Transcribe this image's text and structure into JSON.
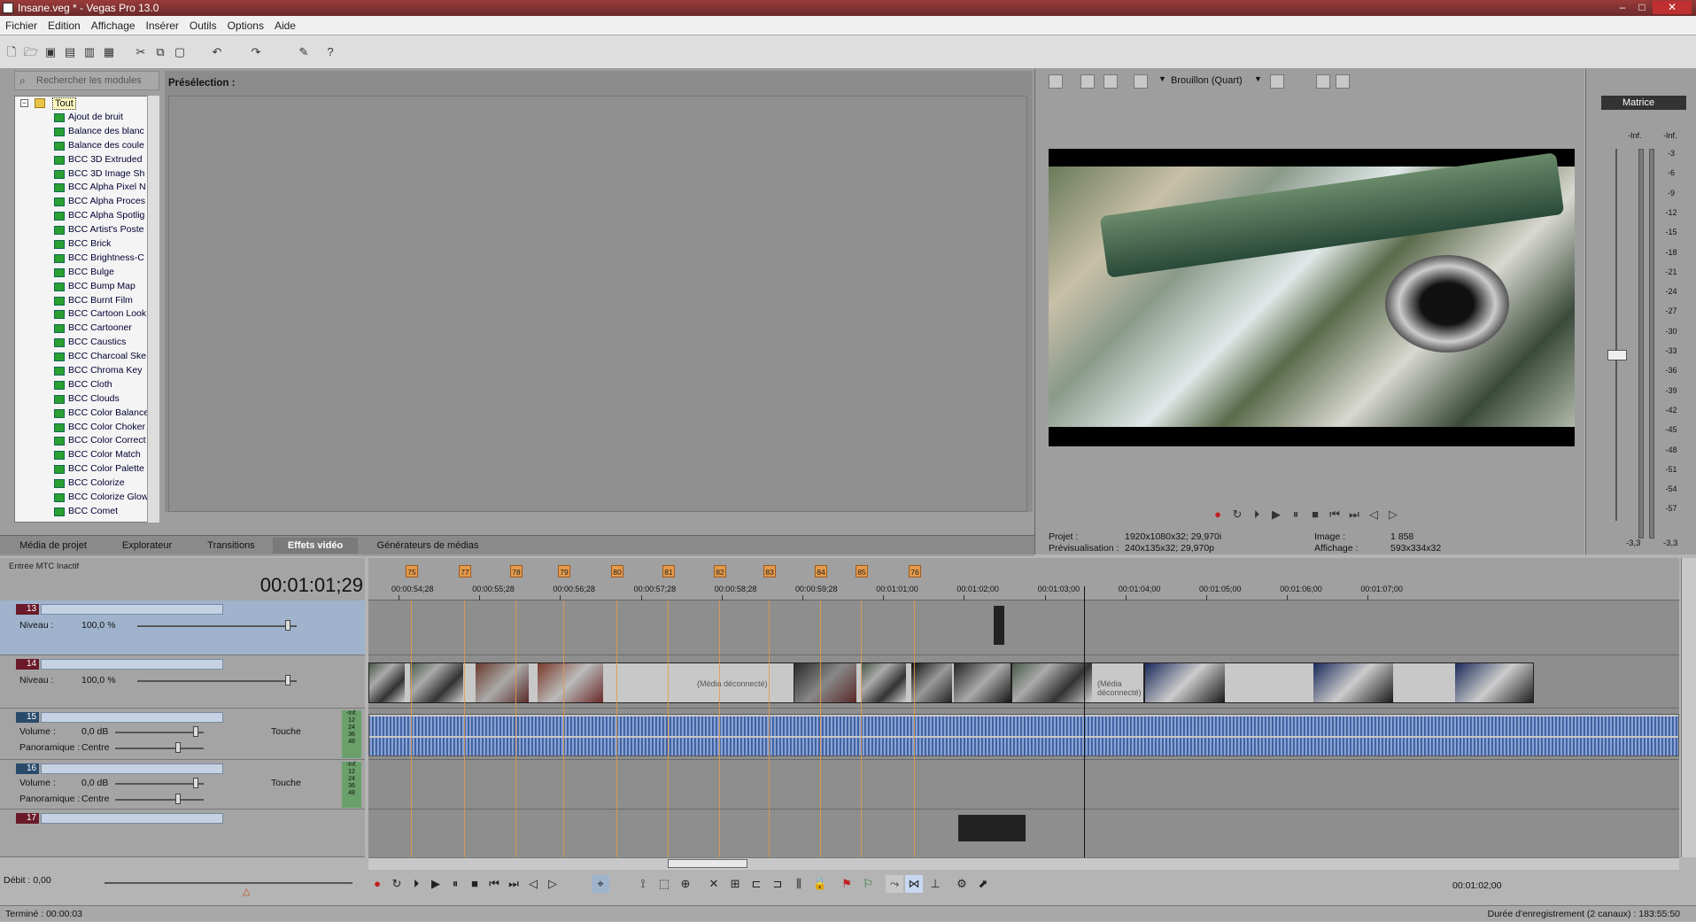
{
  "window": {
    "title": "Insane.veg * - Vegas Pro 13.0",
    "controls": [
      "–",
      "□",
      "✕"
    ]
  },
  "menu": [
    "Fichier",
    "Edition",
    "Affichage",
    "Insérer",
    "Outils",
    "Options",
    "Aide"
  ],
  "fx": {
    "search_placeholder": "Rechercher les modules",
    "root": "Tout",
    "items": [
      "Ajout de bruit",
      "Balance des blanc",
      "Balance des coule",
      "BCC 3D Extruded",
      "BCC 3D Image Sh",
      "BCC Alpha Pixel N",
      "BCC Alpha Proces",
      "BCC Alpha Spotlig",
      "BCC Artist's Poste",
      "BCC Brick",
      "BCC Brightness-C",
      "BCC Bulge",
      "BCC Bump Map",
      "BCC Burnt Film",
      "BCC Cartoon Look",
      "BCC Cartooner",
      "BCC Caustics",
      "BCC Charcoal Ske",
      "BCC Chroma Key",
      "BCC Cloth",
      "BCC Clouds",
      "BCC Color Balance",
      "BCC Color Choker",
      "BCC Color Correct",
      "BCC Color Match",
      "BCC Color Palette",
      "BCC Colorize",
      "BCC Colorize Glow",
      "BCC Comet"
    ],
    "preselection_label": "Présélection :"
  },
  "bottom_tabs": [
    "Média de projet",
    "Explorateur",
    "Transitions",
    "Effets vidéo",
    "Générateurs de médias"
  ],
  "active_tab": "Effets vidéo",
  "preview": {
    "quality": "Brouillon (Quart)",
    "projet_label": "Projet :",
    "projet_value": "1920x1080x32; 29,970i",
    "previs_label": "Prévisualisation :",
    "previs_value": "240x135x32; 29,970p",
    "image_label": "Image :",
    "image_value": "1 858",
    "affichage_label": "Affichage :",
    "affichage_value": "593x334x32"
  },
  "mixer": {
    "label": "Matrice",
    "inf": "-Inf.",
    "scale": [
      "-3",
      "-6",
      "-9",
      "-12",
      "-15",
      "-18",
      "-21",
      "-24",
      "-27",
      "-30",
      "-33",
      "-36",
      "-39",
      "-42",
      "-45",
      "-48",
      "-51",
      "-54",
      "-57"
    ],
    "bottom_left": "-3,3",
    "bottom_right": "-3,3"
  },
  "timeline": {
    "mtc": "Entrée MTC Inactif",
    "timecode": "00:01:01;29",
    "markers": [
      "75",
      "77",
      "78",
      "79",
      "80",
      "81",
      "82",
      "83",
      "84",
      "85",
      "76"
    ],
    "ticks": [
      "00:00:54;28",
      "00:00:55;28",
      "00:00:56;28",
      "00:00:57;28",
      "00:00:58;28",
      "00:00:59;28",
      "00:01:01;00",
      "00:01:02;00",
      "00:01:03;00",
      "00:01:04;00",
      "00:01:05;00",
      "00:01:06;00",
      "00:01:07;00"
    ],
    "disconnected": "(Média déconnecté)"
  },
  "tracks": [
    {
      "num": "13",
      "kind": "video",
      "level_label": "Niveau :",
      "level": "100,0 %"
    },
    {
      "num": "14",
      "kind": "video",
      "level_label": "Niveau :",
      "level": "100,0 %"
    },
    {
      "num": "15",
      "kind": "audio",
      "vol_label": "Volume :",
      "vol": "0,0 dB",
      "pan_label": "Panoramique :",
      "pan": "Centre",
      "mode": "Touche",
      "meter": [
        "-Inf.",
        "12",
        "24",
        "36",
        "48"
      ]
    },
    {
      "num": "16",
      "kind": "audio",
      "vol_label": "Volume :",
      "vol": "0,0 dB",
      "pan_label": "Panoramique :",
      "pan": "Centre",
      "mode": "Touche",
      "meter": [
        "-Inf.",
        "12",
        "24",
        "36",
        "48"
      ]
    },
    {
      "num": "17",
      "kind": "video"
    }
  ],
  "debit": "Débit : 0,00",
  "cursor_time": "00:01:02;00",
  "status": {
    "left": "Terminé : 00:00:03",
    "right": "Durée d'enregistrement (2 canaux) : 183:55:50"
  },
  "colors": {
    "accent": "#e49a4a",
    "selected_track": "#9fb4cc",
    "title_bar": "#8a3535"
  }
}
